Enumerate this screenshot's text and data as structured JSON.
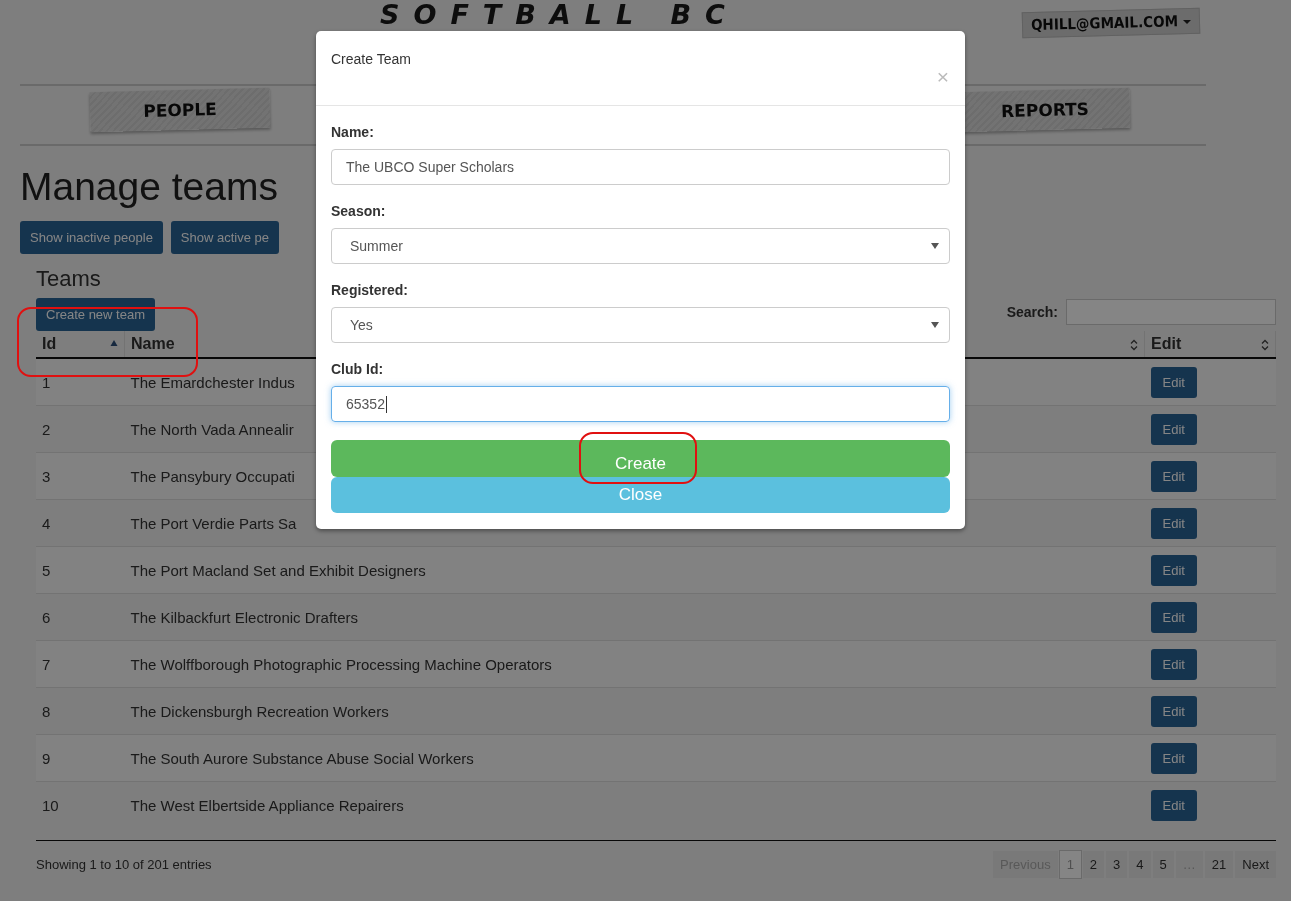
{
  "header": {
    "logo": "SOFTBALL BC",
    "user_menu": "QHILL@GMAIL.COM",
    "nav": [
      {
        "label": "PEOPLE"
      },
      {
        "label": "REPORTS"
      }
    ]
  },
  "page": {
    "title": "Manage teams",
    "buttons": [
      "Show inactive people",
      "Show active pe"
    ],
    "section_title": "Teams",
    "create_button": "Create new team",
    "search_label": "Search:"
  },
  "table": {
    "columns": [
      {
        "label": "Id",
        "sorted": true
      },
      {
        "label": "Name",
        "sorted": false
      },
      {
        "label": "Edit",
        "sorted": false
      }
    ],
    "rows": [
      {
        "id": "1",
        "name": "The Emardchester Indus",
        "action": "Edit"
      },
      {
        "id": "2",
        "name": "The North Vada Annealir",
        "action": "Edit"
      },
      {
        "id": "3",
        "name": "The Pansybury Occupati",
        "action": "Edit"
      },
      {
        "id": "4",
        "name": "The Port Verdie Parts Sa",
        "action": "Edit"
      },
      {
        "id": "5",
        "name": "The Port Macland Set and Exhibit Designers",
        "action": "Edit"
      },
      {
        "id": "6",
        "name": "The Kilbackfurt Electronic Drafters",
        "action": "Edit"
      },
      {
        "id": "7",
        "name": "The Wolffborough Photographic Processing Machine Operators",
        "action": "Edit"
      },
      {
        "id": "8",
        "name": "The Dickensburgh Recreation Workers",
        "action": "Edit"
      },
      {
        "id": "9",
        "name": "The South Aurore Substance Abuse Social Workers",
        "action": "Edit"
      },
      {
        "id": "10",
        "name": "The West Elbertside Appliance Repairers",
        "action": "Edit"
      }
    ]
  },
  "footer": {
    "info": "Showing 1 to 10 of 201 entries",
    "pages": [
      {
        "label": "Previous",
        "disabled": true,
        "selected": false
      },
      {
        "label": "1",
        "disabled": false,
        "selected": true
      },
      {
        "label": "2",
        "disabled": false,
        "selected": false
      },
      {
        "label": "3",
        "disabled": false,
        "selected": false
      },
      {
        "label": "4",
        "disabled": false,
        "selected": false
      },
      {
        "label": "5",
        "disabled": false,
        "selected": false
      },
      {
        "label": "…",
        "disabled": true,
        "selected": false
      },
      {
        "label": "21",
        "disabled": false,
        "selected": false
      },
      {
        "label": "Next",
        "disabled": false,
        "selected": false
      }
    ]
  },
  "modal": {
    "title": "Create Team",
    "close_icon": "×",
    "fields": [
      {
        "label": "Name:",
        "kind": "text",
        "value": "The UBCO Super Scholars",
        "focused": false
      },
      {
        "label": "Season:",
        "kind": "select",
        "value": "Summer",
        "focused": false
      },
      {
        "label": "Registered:",
        "kind": "select",
        "value": "Yes",
        "focused": false
      },
      {
        "label": "Club Id:",
        "kind": "text",
        "value": "65352",
        "focused": true
      }
    ],
    "buttons": [
      {
        "label": "Create",
        "kind": "success"
      },
      {
        "label": "Close",
        "kind": "info"
      }
    ]
  }
}
